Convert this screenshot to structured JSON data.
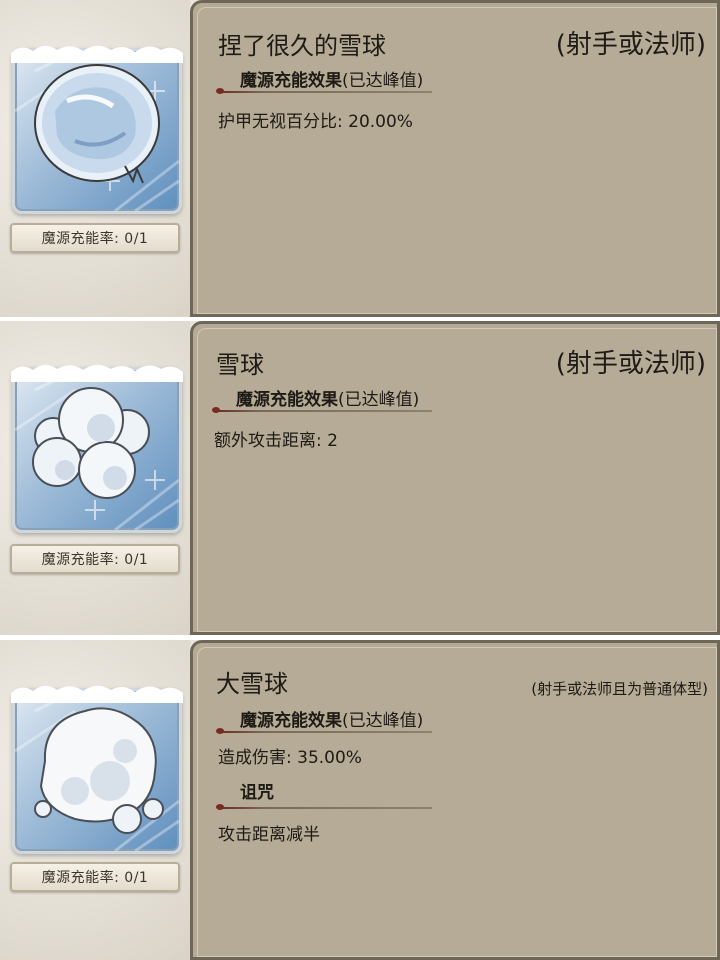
{
  "items": [
    {
      "title": "捏了很久的雪球",
      "role": "(射手或法师)",
      "charge_rate": "魔源充能率: 0/1",
      "section1_header": "魔源充能效果",
      "section1_status": "(已达峰值)",
      "stat": "护甲无视百分比: 20.00%",
      "icon": "packed-snowball-icon"
    },
    {
      "title": "雪球",
      "role": "(射手或法师)",
      "charge_rate": "魔源充能率: 0/1",
      "section1_header": "魔源充能效果",
      "section1_status": "(已达峰值)",
      "stat": "额外攻击距离: 2",
      "icon": "snowball-cluster-icon"
    },
    {
      "title": "大雪球",
      "role": "(射手或法师且为普通体型)",
      "charge_rate": "魔源充能率: 0/1",
      "section1_header": "魔源充能效果",
      "section1_status": "(已达峰值)",
      "stat": "造成伤害: 35.00%",
      "section2_header": "诅咒",
      "stat2": "攻击距离减半",
      "icon": "big-snowball-icon"
    }
  ],
  "colors": {
    "panel_bg": "#b5ab97",
    "panel_border": "#6e6657",
    "text": "#1e1a14",
    "card_blue": "#5f8fbe",
    "accent_red": "#7a2a1e"
  }
}
